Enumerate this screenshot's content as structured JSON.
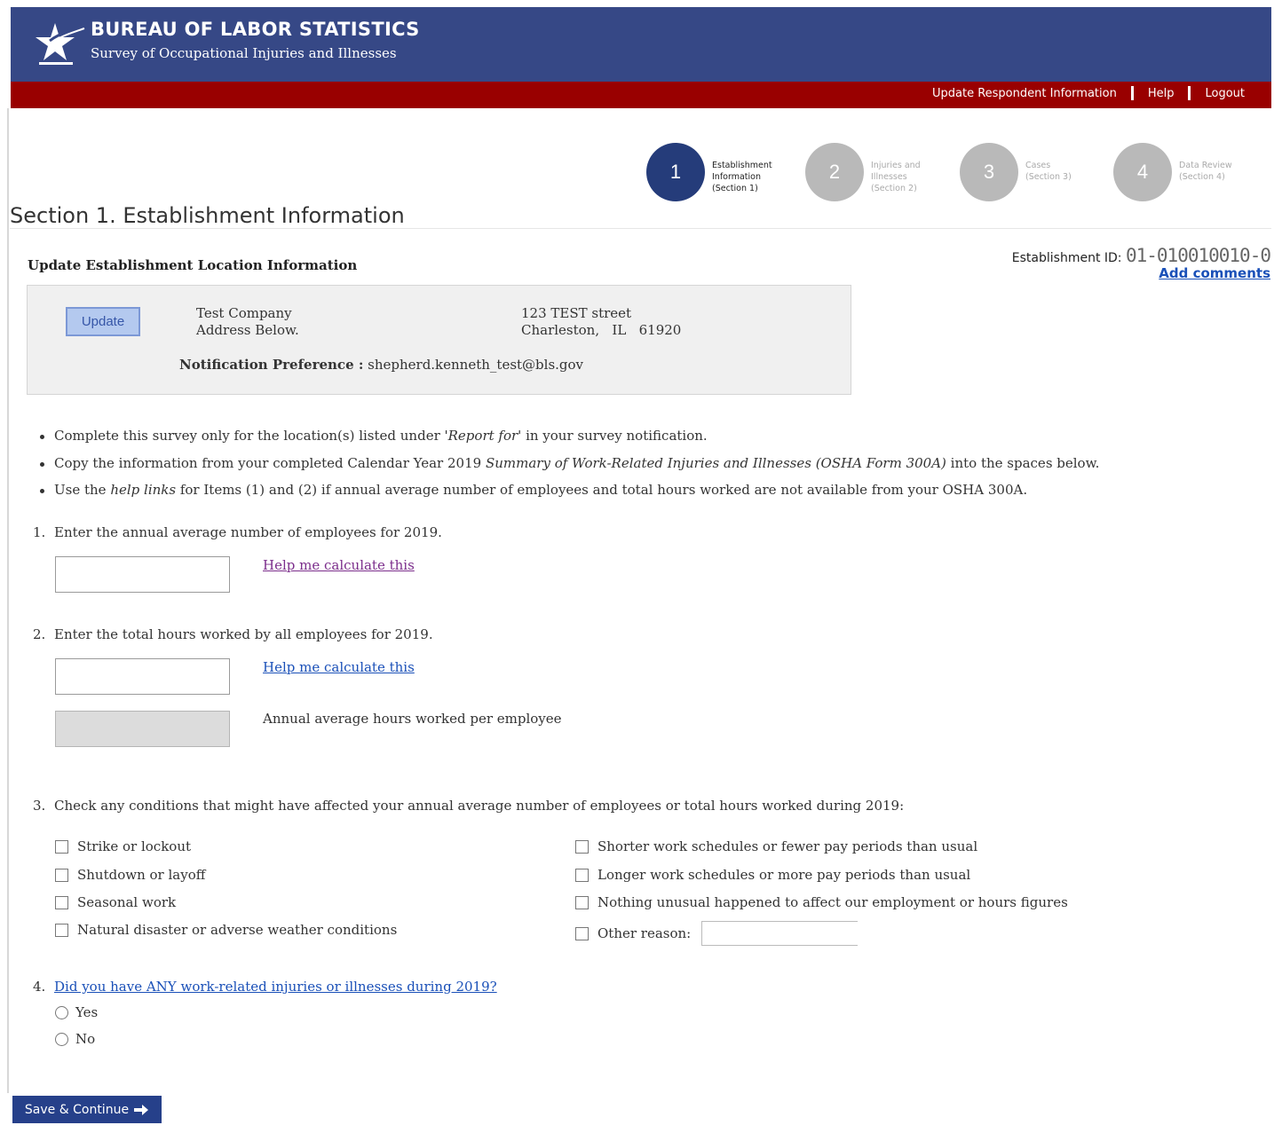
{
  "header": {
    "title": "BUREAU OF LABOR STATISTICS",
    "subtitle": "Survey of Occupational Injuries and Illnesses",
    "logo_icon": "bls-star-logo-icon",
    "colors": {
      "header_blue": "#364886",
      "redbar": "#990000",
      "active_step": "#253c7a",
      "inactive_step": "#b9b9b9"
    }
  },
  "util_nav": {
    "update_respondent": "Update Respondent Information",
    "help": "Help",
    "logout": "Logout"
  },
  "steps": [
    {
      "number": "1",
      "line1": "Establishment",
      "line2": "Information",
      "line3": "(Section 1)"
    },
    {
      "number": "2",
      "line1": "Injuries and",
      "line2": "Illnesses",
      "line3": "(Section 2)"
    },
    {
      "number": "3",
      "line1": "Cases",
      "line2": "(Section 3)"
    },
    {
      "number": "4",
      "line1": "Data Review",
      "line2": "(Section 4)"
    }
  ],
  "section_title": "Section 1. Establishment Information",
  "establishment": {
    "subhead": "Update Establishment Location Information",
    "id_label": "Establishment ID:",
    "id_value": "01-010010010-0",
    "add_comments": "Add comments",
    "update_button": "Update",
    "company_name": "Test Company",
    "company_note": "Address Below.",
    "street": "123 TEST street",
    "city_state_zip": "Charleston,   IL   61920",
    "notification_label": "Notification Preference :",
    "notification_value": " shepherd.kenneth_test@bls.gov"
  },
  "bullets": {
    "b1_pre": "Complete this survey only for the location(s) listed under ",
    "b1_italic": "'Report for'",
    "b1_post": " in your survey notification.",
    "b2_pre": "Copy the information from your completed Calendar Year 2019 ",
    "b2_italic": "Summary of Work-Related Injuries and Illnesses (OSHA Form 300A)",
    "b2_post": " into the spaces below.",
    "b3_pre": "Use the ",
    "b3_italic": "help links",
    "b3_post": " for Items (1) and (2) if annual average number of employees and total hours worked are not available from your OSHA 300A."
  },
  "q1": {
    "number": "1.",
    "text": "Enter the annual average number of employees for 2019.",
    "value": "",
    "help_link": "Help me calculate this"
  },
  "q2": {
    "number": "2.",
    "text": "Enter the total hours worked by all employees for 2019.",
    "value": "",
    "help_link": "Help me calculate this",
    "avg_label": "Annual average hours worked per employee"
  },
  "q3": {
    "number": "3.",
    "text": "Check any conditions that might have affected your annual average number of employees or total hours worked during 2019:",
    "left_options": [
      "Strike or lockout",
      "Shutdown or layoff",
      "Seasonal work",
      "Natural disaster or adverse weather conditions"
    ],
    "right_options": [
      "Shorter work schedules or fewer pay periods than usual",
      "Longer work schedules or more pay periods than usual",
      "Nothing unusual happened to affect our employment or hours figures",
      "Other reason:"
    ],
    "other_value": ""
  },
  "q4": {
    "number": "4.",
    "text": "Did you have ANY work-related injuries or illnesses during 2019?",
    "yes": "Yes",
    "no": "No"
  },
  "save_button": "Save & Continue"
}
